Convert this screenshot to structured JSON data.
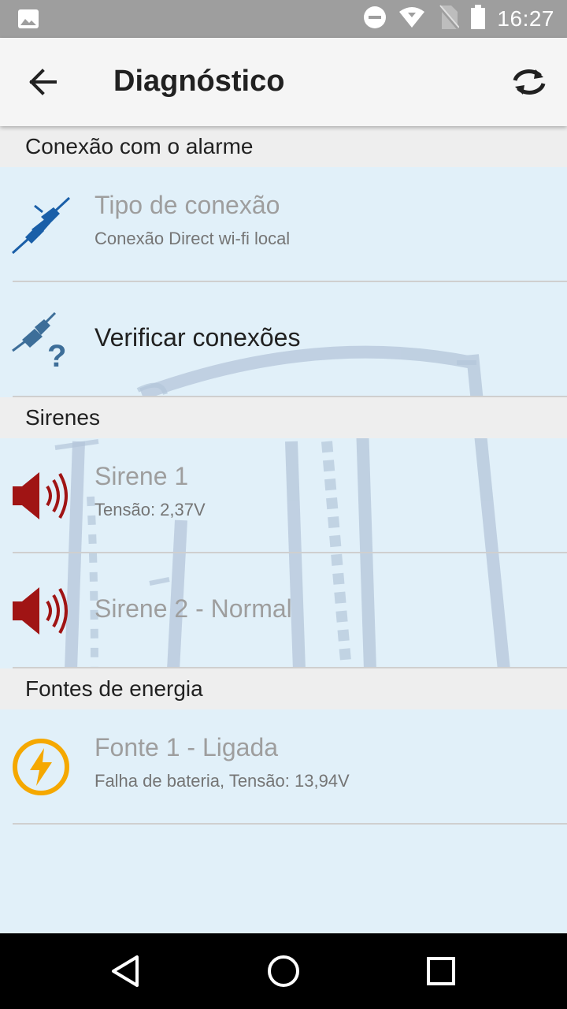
{
  "status_bar": {
    "time": "16:27",
    "icons": [
      "image-icon",
      "do-not-disturb-icon",
      "wifi-icon",
      "no-sim-icon",
      "battery-icon"
    ]
  },
  "app_bar": {
    "title": "Diagnóstico",
    "back_icon": "arrow-back-icon",
    "refresh_icon": "sync-icon"
  },
  "sections": {
    "connection": "Conexão com o alarme",
    "sirens": "Sirenes",
    "power": "Fontes de energia"
  },
  "items": {
    "connection_type": {
      "title": "Tipo de conexão",
      "subtitle": "Conexão Direct wi-fi local",
      "icon": "plug-icon"
    },
    "check_connections": {
      "title": "Verificar conexões",
      "icon": "plug-question-icon"
    },
    "siren1": {
      "title": "Sirene 1",
      "subtitle": "Tensão: 2,37V",
      "icon": "speaker-icon"
    },
    "siren2": {
      "title": "Sirene 2 - Normal",
      "icon": "speaker-icon"
    },
    "source1": {
      "title": "Fonte 1 - Ligada",
      "subtitle": "Falha de bateria, Tensão: 13,94V",
      "icon": "lightning-icon"
    }
  },
  "colors": {
    "status_bar": "#9e9e9e",
    "app_bar": "#f5f5f5",
    "content_bg": "#e1f0f9",
    "section_bg": "#eeeeee",
    "plug_blue": "#1a5fa8",
    "speaker_red": "#a01414",
    "lightning_orange": "#f5a800"
  },
  "nav_bar": {
    "icons": [
      "back-triangle-icon",
      "home-circle-icon",
      "recents-square-icon"
    ]
  }
}
